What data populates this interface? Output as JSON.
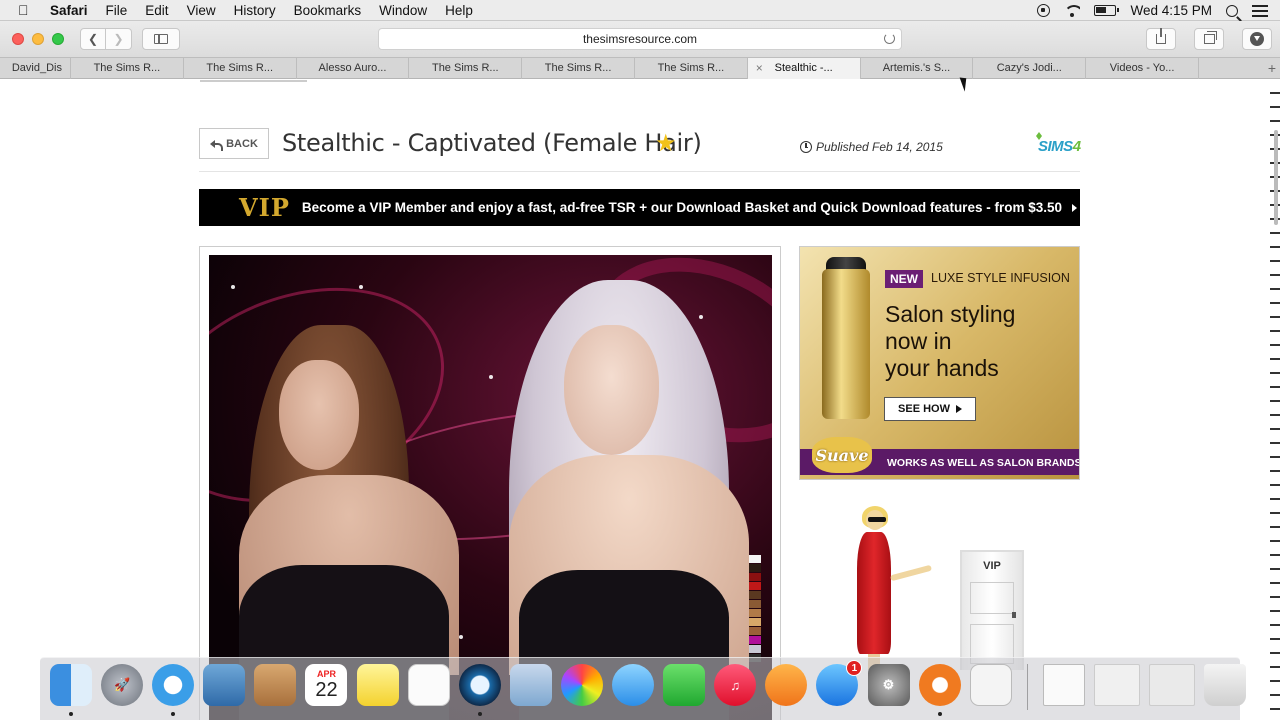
{
  "menubar": {
    "app_name": "Safari",
    "items": [
      "File",
      "Edit",
      "View",
      "History",
      "Bookmarks",
      "Window",
      "Help"
    ],
    "clock": "Wed 4:15 PM"
  },
  "browser": {
    "url": "thesimsresource.com",
    "tabs": [
      {
        "label": "David_Dis"
      },
      {
        "label": "The Sims R..."
      },
      {
        "label": "The Sims R..."
      },
      {
        "label": "Alesso Auro..."
      },
      {
        "label": "The Sims R..."
      },
      {
        "label": "The Sims R..."
      },
      {
        "label": "The Sims R..."
      },
      {
        "label": "Stealthic -..."
      },
      {
        "label": "Artemis.'s S..."
      },
      {
        "label": "Cazy's Jodi..."
      },
      {
        "label": "Videos - Yo..."
      }
    ],
    "active_tab_index": 7,
    "tab_plus": "+"
  },
  "page": {
    "back_label": "BACK",
    "title": "Stealthic - Captivated (Female Hair)",
    "published": "Published Feb 14, 2015",
    "game_logo": "SIMS",
    "game_logo_num": "4",
    "vip_logo": "VIP",
    "vip_text": "Become a VIP Member and enjoy a fast, ad-free TSR + our Download Basket and Quick Download features - from $3.50"
  },
  "ad": {
    "new_label": "NEW",
    "line": "LUXE STYLE INFUSION",
    "headline": "Salon styling\nnow in\nyour hands",
    "cta": "SEE HOW",
    "footer": "WORKS AS WELL AS SALON BRANDS",
    "brand": "Suave"
  },
  "vip_promo": {
    "door_label": "VIP"
  },
  "dock": {
    "calendar_month": "APR",
    "calendar_day": "22",
    "appstore_badge": "1"
  },
  "colors": {
    "vip_gold": "#d3a82e",
    "star": "#f2c21a",
    "sims_blue": "#2aa0c8",
    "sims_green": "#6cbd3e",
    "ad_purple": "#6b1f74"
  }
}
